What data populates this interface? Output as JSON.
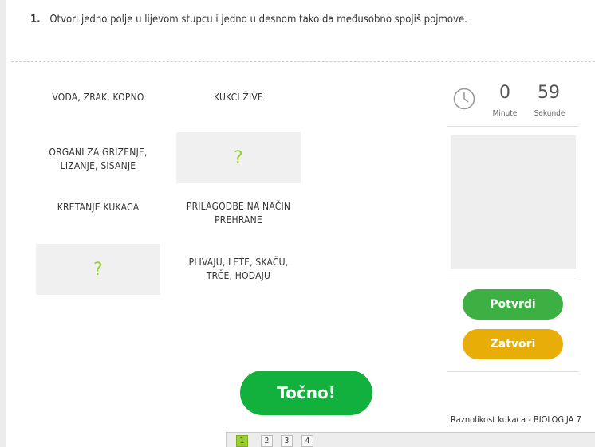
{
  "question": {
    "number": "1.",
    "text": "Otvori jedno polje u lijevom stupcu i jedno u desnom tako da međusobno spojiš pojmove."
  },
  "left_column": [
    "VODA, ZRAK, KOPNO",
    "ORGANI ZA GRIZENJE,\nLIZANJE, SISANJE",
    "KRETANJE KUKACA",
    "?"
  ],
  "right_column": [
    "KUKCI ŽIVE",
    "?",
    "PRILAGODBE NA NAČIN\nPREHRANE",
    "PLIVAJU, LETE, SKAČU,\nTRČE, HODAJU"
  ],
  "timer": {
    "minutes": "0",
    "seconds": "59",
    "minutes_label": "Minute",
    "seconds_label": "Sekunde"
  },
  "buttons": {
    "confirm": "Potvrdi",
    "close": "Zatvori",
    "result": "Točno!"
  },
  "footer": {
    "title": "Raznolikost kukaca - BIOLOGIJA 7"
  },
  "pager": {
    "pages": [
      "1",
      "2",
      "3",
      "4"
    ],
    "active_page": "1"
  },
  "colors": {
    "question_mark": "#9acd32",
    "confirm": "#3cb043",
    "close": "#e8ad06",
    "result": "#12b03c"
  }
}
